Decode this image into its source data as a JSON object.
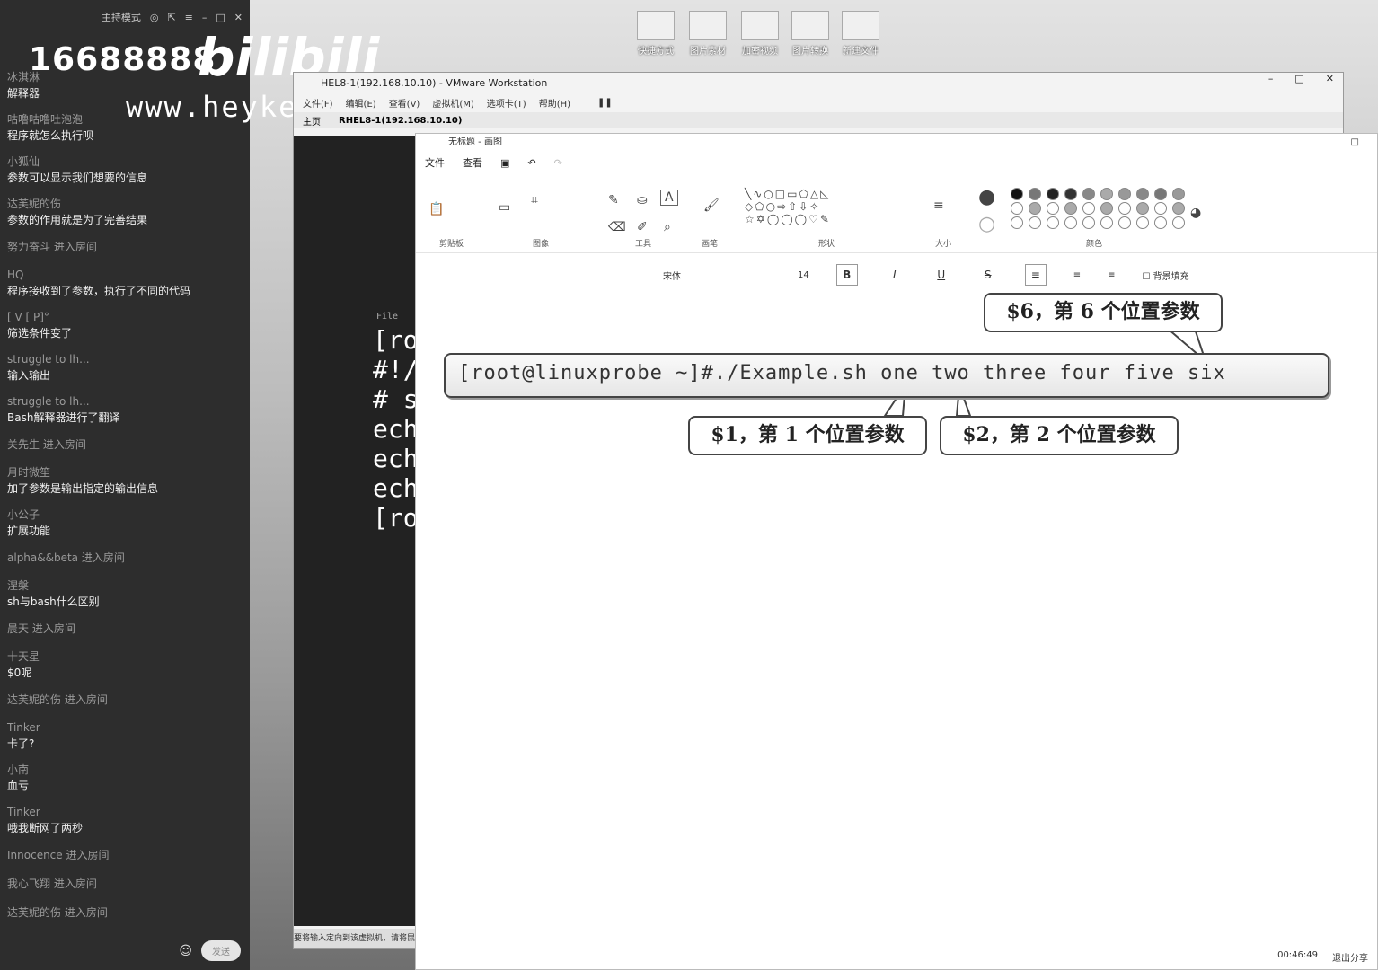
{
  "chat": {
    "mode_label": "主持模式",
    "watermark_number": "16688888",
    "watermark_logo": "bilibili",
    "watermark_url": "www.heyke123.com",
    "messages": [
      {
        "user": "冰淇淋",
        "text": "解释器"
      },
      {
        "user": "咕噜咕噜吐泡泡",
        "text": "程序就怎么执行呗"
      },
      {
        "user": "小狐仙",
        "text": "参数可以显示我们想要的信息"
      },
      {
        "user": "达芙妮的伤",
        "text": "参数的作用就是为了完善结果"
      },
      {
        "join": "努力奋斗 进入房间"
      },
      {
        "user": "HQ",
        "text": "程序接收到了参数，执行了不同的代码"
      },
      {
        "user": "[ V [ P]°",
        "text": "筛选条件变了"
      },
      {
        "user": "struggle to lh...",
        "text": "输入输出"
      },
      {
        "user": "struggle to lh...",
        "text": "Bash解释器进行了翻译"
      },
      {
        "join": "关先生 进入房间"
      },
      {
        "user": "月时微笙",
        "text": "加了参数是输出指定的输出信息"
      },
      {
        "user": "小公子",
        "text": "扩展功能"
      },
      {
        "join": "alpha&&beta 进入房间"
      },
      {
        "user": "涅槃",
        "text": "sh与bash什么区别"
      },
      {
        "join": "晨天 进入房间"
      },
      {
        "user": "十天星",
        "text": "$0呢"
      },
      {
        "join": "达芙妮的伤 进入房间"
      },
      {
        "user": "Tinker",
        "text": "卡了?"
      },
      {
        "user": "小南",
        "text": "血亏"
      },
      {
        "user": "Tinker",
        "text": "哦我断网了两秒"
      },
      {
        "join": "Innocence 进入房间"
      },
      {
        "join": "我心飞翔 进入房间"
      },
      {
        "join": "达芙妮的伤 进入房间"
      }
    ],
    "send_label": "发送"
  },
  "desktop": {
    "icons": [
      "快捷方式",
      "图片素材",
      "加密视频",
      "图片转换",
      "新建文件"
    ]
  },
  "vmware": {
    "title": "HEL8-1(192.168.10.10) - VMware Workstation",
    "menu": [
      "文件(F)",
      "编辑(E)",
      "查看(V)",
      "虚拟机(M)",
      "选项卡(T)",
      "帮助(H)"
    ],
    "tabs": [
      "主页",
      "RHEL8-1(192.168.10.10)"
    ],
    "terminal_lines": [
      "[ro",
      "#!/",
      "# s",
      "ech",
      "ech",
      "ech",
      "[ro"
    ],
    "terminal_menu": "File",
    "status": "要将输入定向到该虚拟机，请将鼠标指针移入其中或按 Ctrl+G。"
  },
  "paint": {
    "title": "无标题 - 画图",
    "menu": [
      "文件",
      "查看"
    ],
    "groups": [
      "剪贴板",
      "图像",
      "工具",
      "画笔",
      "形状",
      "大小",
      "颜色"
    ],
    "font_name": "宋体",
    "font_size": "14",
    "fill_bg_label": "背景填充",
    "timer": "00:46:49",
    "exit_share": "退出分享"
  },
  "figure": {
    "command": "[root@linuxprobe ~]#./Example.sh one two three four five six",
    "callout_6": "$6，第 6 个位置参数",
    "callout_1": "$1，第 1 个位置参数",
    "callout_2": "$2，第 2 个位置参数"
  }
}
